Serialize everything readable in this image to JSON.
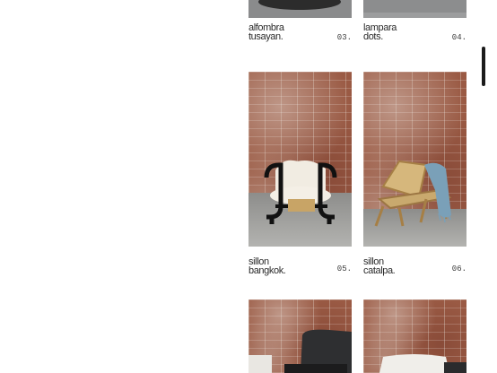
{
  "products": [
    {
      "name": "alfombra\ntusayan.",
      "number": "03."
    },
    {
      "name": "lampara\ndots.",
      "number": "04."
    },
    {
      "name": "sillon\nbangkok.",
      "number": "05."
    },
    {
      "name": "sillon\ncatalpa.",
      "number": "06."
    }
  ],
  "colors": {
    "text": "#2a2a2a",
    "scroll_thumb": "#1b1b1b",
    "brick": "#9a5a44",
    "floor": "#a3a3a0"
  }
}
